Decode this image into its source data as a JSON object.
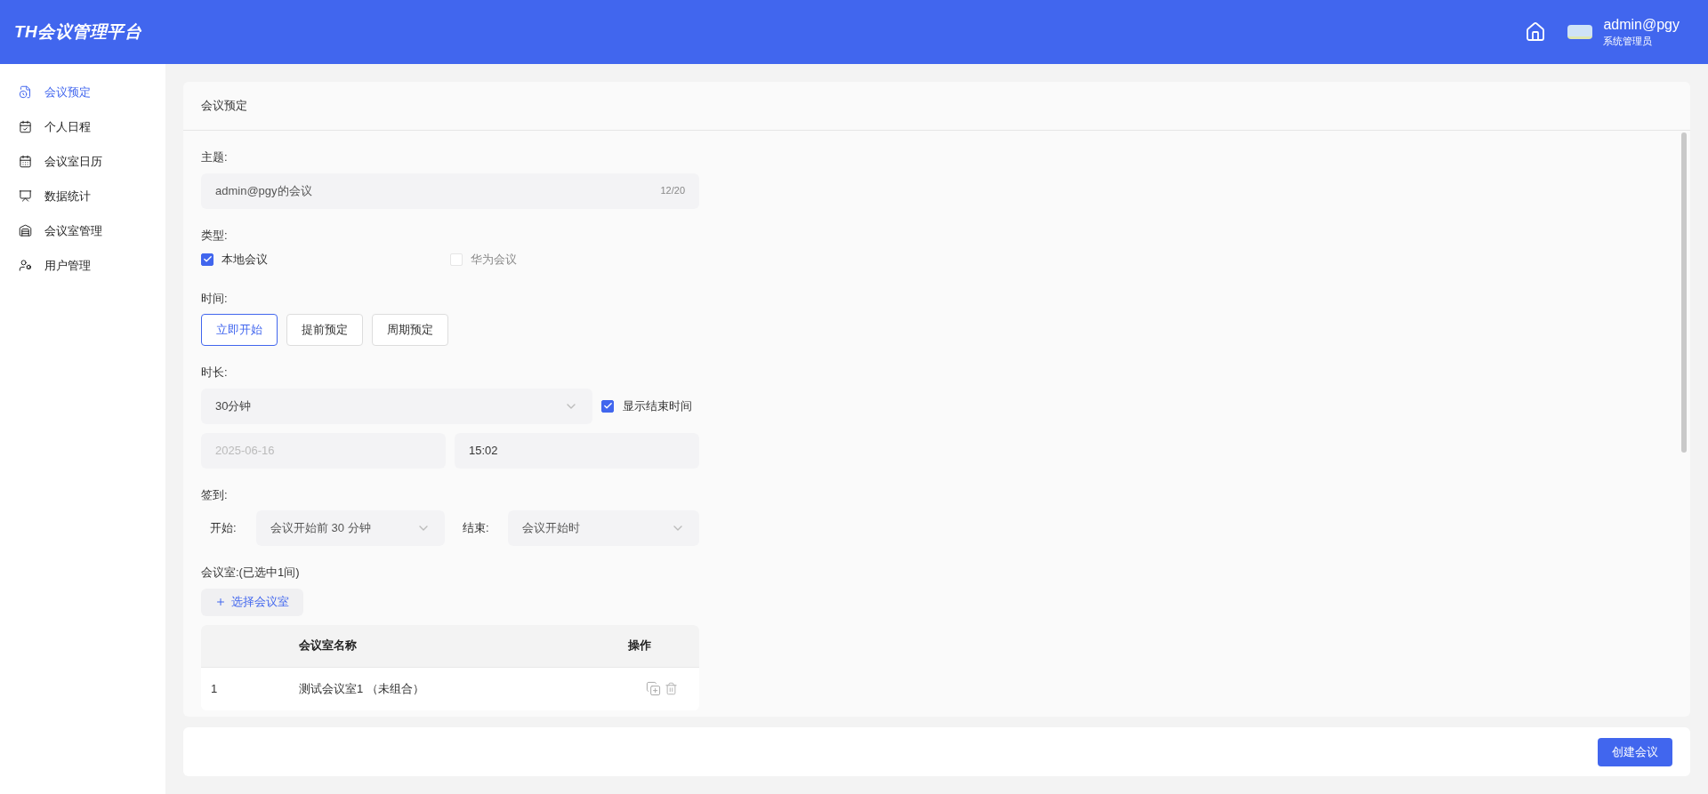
{
  "header": {
    "logo": "TH会议管理平台",
    "user": {
      "name": "admin@pgy",
      "role": "系统管理员"
    }
  },
  "sidebar": {
    "items": [
      {
        "label": "会议预定",
        "selected": true
      },
      {
        "label": "个人日程",
        "selected": false
      },
      {
        "label": "会议室日历",
        "selected": false
      },
      {
        "label": "数据统计",
        "selected": false
      },
      {
        "label": "会议室管理",
        "selected": false
      },
      {
        "label": "用户管理",
        "selected": false
      }
    ]
  },
  "card": {
    "title": "会议预定"
  },
  "form": {
    "subject": {
      "label": "主题:",
      "value": "admin@pgy的会议",
      "count": "12/20"
    },
    "type": {
      "label": "类型:",
      "options": [
        {
          "label": "本地会议",
          "checked": true,
          "disabled": false
        },
        {
          "label": "华为会议",
          "checked": false,
          "disabled": true
        }
      ]
    },
    "time": {
      "label": "时间:",
      "options": [
        {
          "label": "立即开始",
          "selected": true
        },
        {
          "label": "提前预定",
          "selected": false
        },
        {
          "label": "周期预定",
          "selected": false
        }
      ]
    },
    "duration": {
      "label": "时长:",
      "value": "30分钟",
      "show_end": {
        "label": "显示结束时间",
        "checked": true
      },
      "end_date": "2025-06-16",
      "end_time": "15:02"
    },
    "checkin": {
      "label": "签到:",
      "start_label": "开始:",
      "start_value": "会议开始前 30 分钟",
      "end_label": "结束:",
      "end_value": "会议开始时"
    },
    "rooms": {
      "label": "会议室:(已选中1间)",
      "add_button": "选择会议室",
      "columns": [
        "会议室名称",
        "操作"
      ],
      "rows": [
        {
          "index": "1",
          "name": "测试会议室1 （未组合）"
        }
      ]
    }
  },
  "footer": {
    "submit": "创建会议"
  }
}
